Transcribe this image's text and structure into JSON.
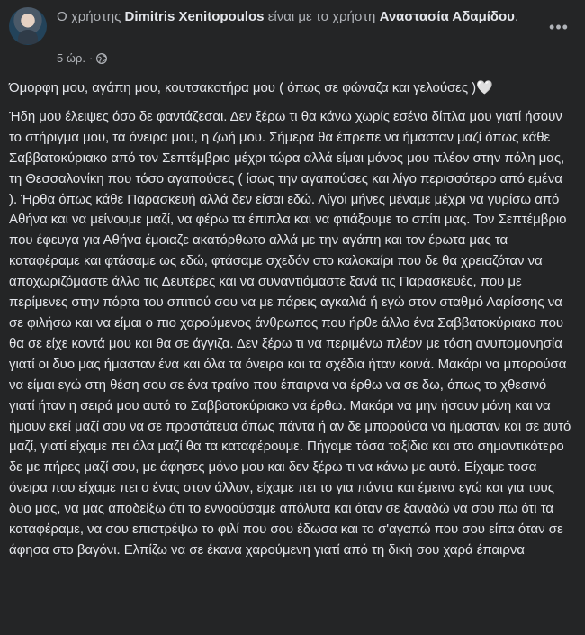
{
  "post": {
    "header": {
      "prefix": "Ο χρήστης ",
      "author": "Dimitris Xenitopoulos",
      "middle": " είναι με το χρήστη ",
      "tagged": "Αναστασία Αδαμίδου",
      "suffix": ".",
      "time": "5 ώρ.",
      "separator": "·",
      "privacy_icon": "globe-icon",
      "more_icon": "more-options-icon"
    },
    "paragraphs": [
      "Όμορφη μου, αγάπη μου, κουτσακοτήρα μου ( όπως σε φώναζα και γελούσες )🤍",
      "Ήδη μου έλειψες όσο δε φαντάζεσαι. Δεν ξέρω τι θα κάνω χωρίς εσένα δίπλα μου γιατί ήσουν το στήριγμα μου, τα όνειρα μου, η ζωή μου. Σήμερα θα έπρεπε να ήμασταν μαζί όπως κάθε Σαββατοκύριακο από τον Σεπτέμβριο μέχρι τώρα αλλά είμαι μόνος μου πλέον στην πόλη μας, τη Θεσσαλονίκη που τόσο αγαπούσες ( ίσως την αγαπούσες και λίγο περισσότερο από εμένα ). Ήρθα όπως κάθε Παρασκευή αλλά δεν είσαι εδώ. Λίγοι μήνες μέναμε μέχρι να γυρίσω από Αθήνα και να μείνουμε μαζί, να φέρω τα έπιπλα και να φτιάξουμε το σπίτι μας. Τον Σεπτέμβριο που έφευγα για Αθήνα έμοιαζε ακατόρθωτο αλλά με την αγάπη και τον έρωτα μας τα καταφέραμε και φτάσαμε ως εδώ, φτάσαμε σχεδόν στο καλοκαίρι που δε θα χρειαζόταν να αποχωριζόμαστε άλλο τις Δευτέρες και να συναντιόμαστε ξανά τις Παρασκευές, που με περίμενες στην πόρτα του σπιτιού σου να με πάρεις αγκαλιά ή εγώ στον σταθμό Λαρίσσης να σε φιλήσω και να είμαι ο πιο χαρούμενος άνθρωπος που ήρθε άλλο ένα Σαββατοκύριακο που θα σε είχε κοντά μου και θα σε άγγιζα. Δεν ξέρω τι να περιμένω πλέον με τόση ανυπομονησία γιατί οι δυο μας ήμασταν ένα και όλα τα όνειρα και τα σχέδια ήταν κοινά. Μακάρι να μπορούσα να είμαι εγώ στη θέση σου σε ένα τραίνο που έπαιρνα να έρθω να σε δω, όπως το χθεσινό γιατί ήταν η σειρά μου αυτό το Σαββατοκύριακο να έρθω. Μακάρι να μην ήσουν μόνη και να ήμουν εκεί μαζί σου να σε προστάτευα όπως πάντα ή αν δε μπορούσα να ήμασταν και σε αυτό μαζί, γιατί είχαμε πει όλα μαζί θα τα καταφέρουμε. Πήγαμε τόσα ταξίδια και στο σημαντικότερο δε με πήρες μαζί σου, με άφησες μόνο μου και δεν ξέρω τι να κάνω με αυτό. Είχαμε τοσα όνειρα που είχαμε πει ο ένας στον άλλον, είχαμε πει το για πάντα και έμεινα εγώ και για τους δυο μας, να μας αποδείξω ότι το εννοούσαμε απόλυτα και όταν σε ξαναδώ να σου πω ότι τα καταφέραμε, να σου επιστρέψω το φιλί που σου έδωσα και το σ'αγαπώ που σου είπα όταν σε άφησα στο βαγόνι. Ελπίζω να σε έκανα χαρούμενη γιατί από τη δική σου χαρά έπαιρνα"
    ]
  }
}
